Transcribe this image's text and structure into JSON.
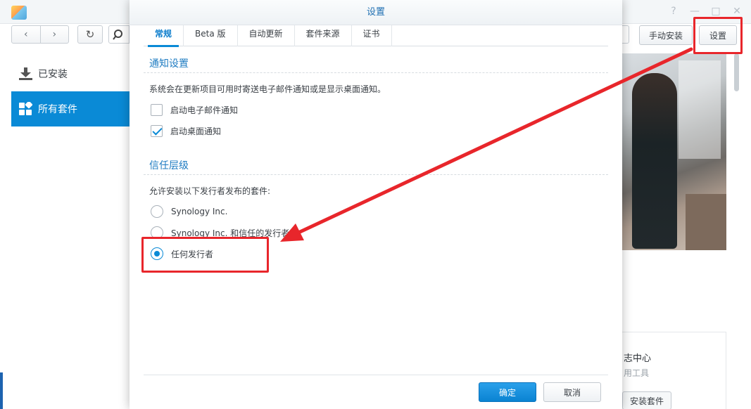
{
  "toolbar": {
    "manual_install_label": "手动安装",
    "settings_label": "设置"
  },
  "sidebar": {
    "items": [
      {
        "label": "已安装",
        "icon": "download-icon"
      },
      {
        "label": "所有套件",
        "icon": "grid-icon"
      }
    ]
  },
  "card": {
    "title": "志中心",
    "subtitle": "用工具",
    "button_label": "安装套件"
  },
  "dialog": {
    "title": "设置",
    "tabs": [
      {
        "label": "常规",
        "active": true
      },
      {
        "label": "Beta 版",
        "active": false
      },
      {
        "label": "自动更新",
        "active": false
      },
      {
        "label": "套件来源",
        "active": false
      },
      {
        "label": "证书",
        "active": false
      }
    ],
    "notify": {
      "title": "通知设置",
      "description": "系统会在更新项目可用时寄送电子邮件通知或是显示桌面通知。",
      "email_label": "启动电子邮件通知",
      "email_checked": false,
      "desktop_label": "启动桌面通知",
      "desktop_checked": true
    },
    "trust": {
      "title": "信任层级",
      "description": "允许安装以下发行者发布的套件:",
      "options": [
        {
          "label": "Synology Inc.",
          "selected": false
        },
        {
          "label": "Synology Inc. 和信任的发行者",
          "selected": false
        },
        {
          "label": "任何发行者",
          "selected": true
        }
      ]
    },
    "ok_label": "确定",
    "cancel_label": "取消"
  },
  "colors": {
    "accent": "#0a8ad6",
    "annotation": "#e8262b"
  }
}
